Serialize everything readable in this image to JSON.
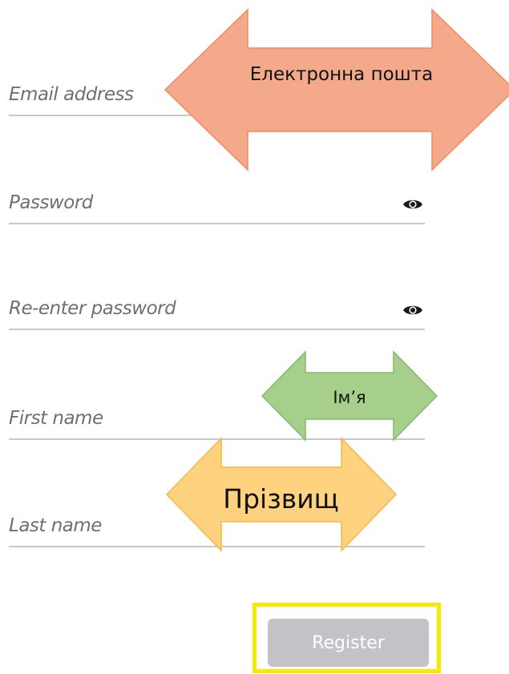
{
  "form": {
    "email_placeholder": "Email address",
    "password_placeholder": "Password",
    "reenter_password_placeholder": "Re-enter password",
    "first_name_placeholder": "First name",
    "last_name_placeholder": "Last name",
    "register_label": "Register",
    "password_toggle_icon": "eye-icon",
    "reenter_password_toggle_icon": "eye-icon"
  },
  "annotations": {
    "email_label": "Електронна пошта",
    "first_name_label": "Ім’я",
    "last_name_label": "Прізвищ"
  },
  "colors": {
    "email_arrow": "#f4a98b",
    "first_name_arrow": "#a6cf8b",
    "last_name_arrow": "#ffd27f",
    "register_highlight": "#f5ea00",
    "register_button": "#c3c3c7"
  }
}
